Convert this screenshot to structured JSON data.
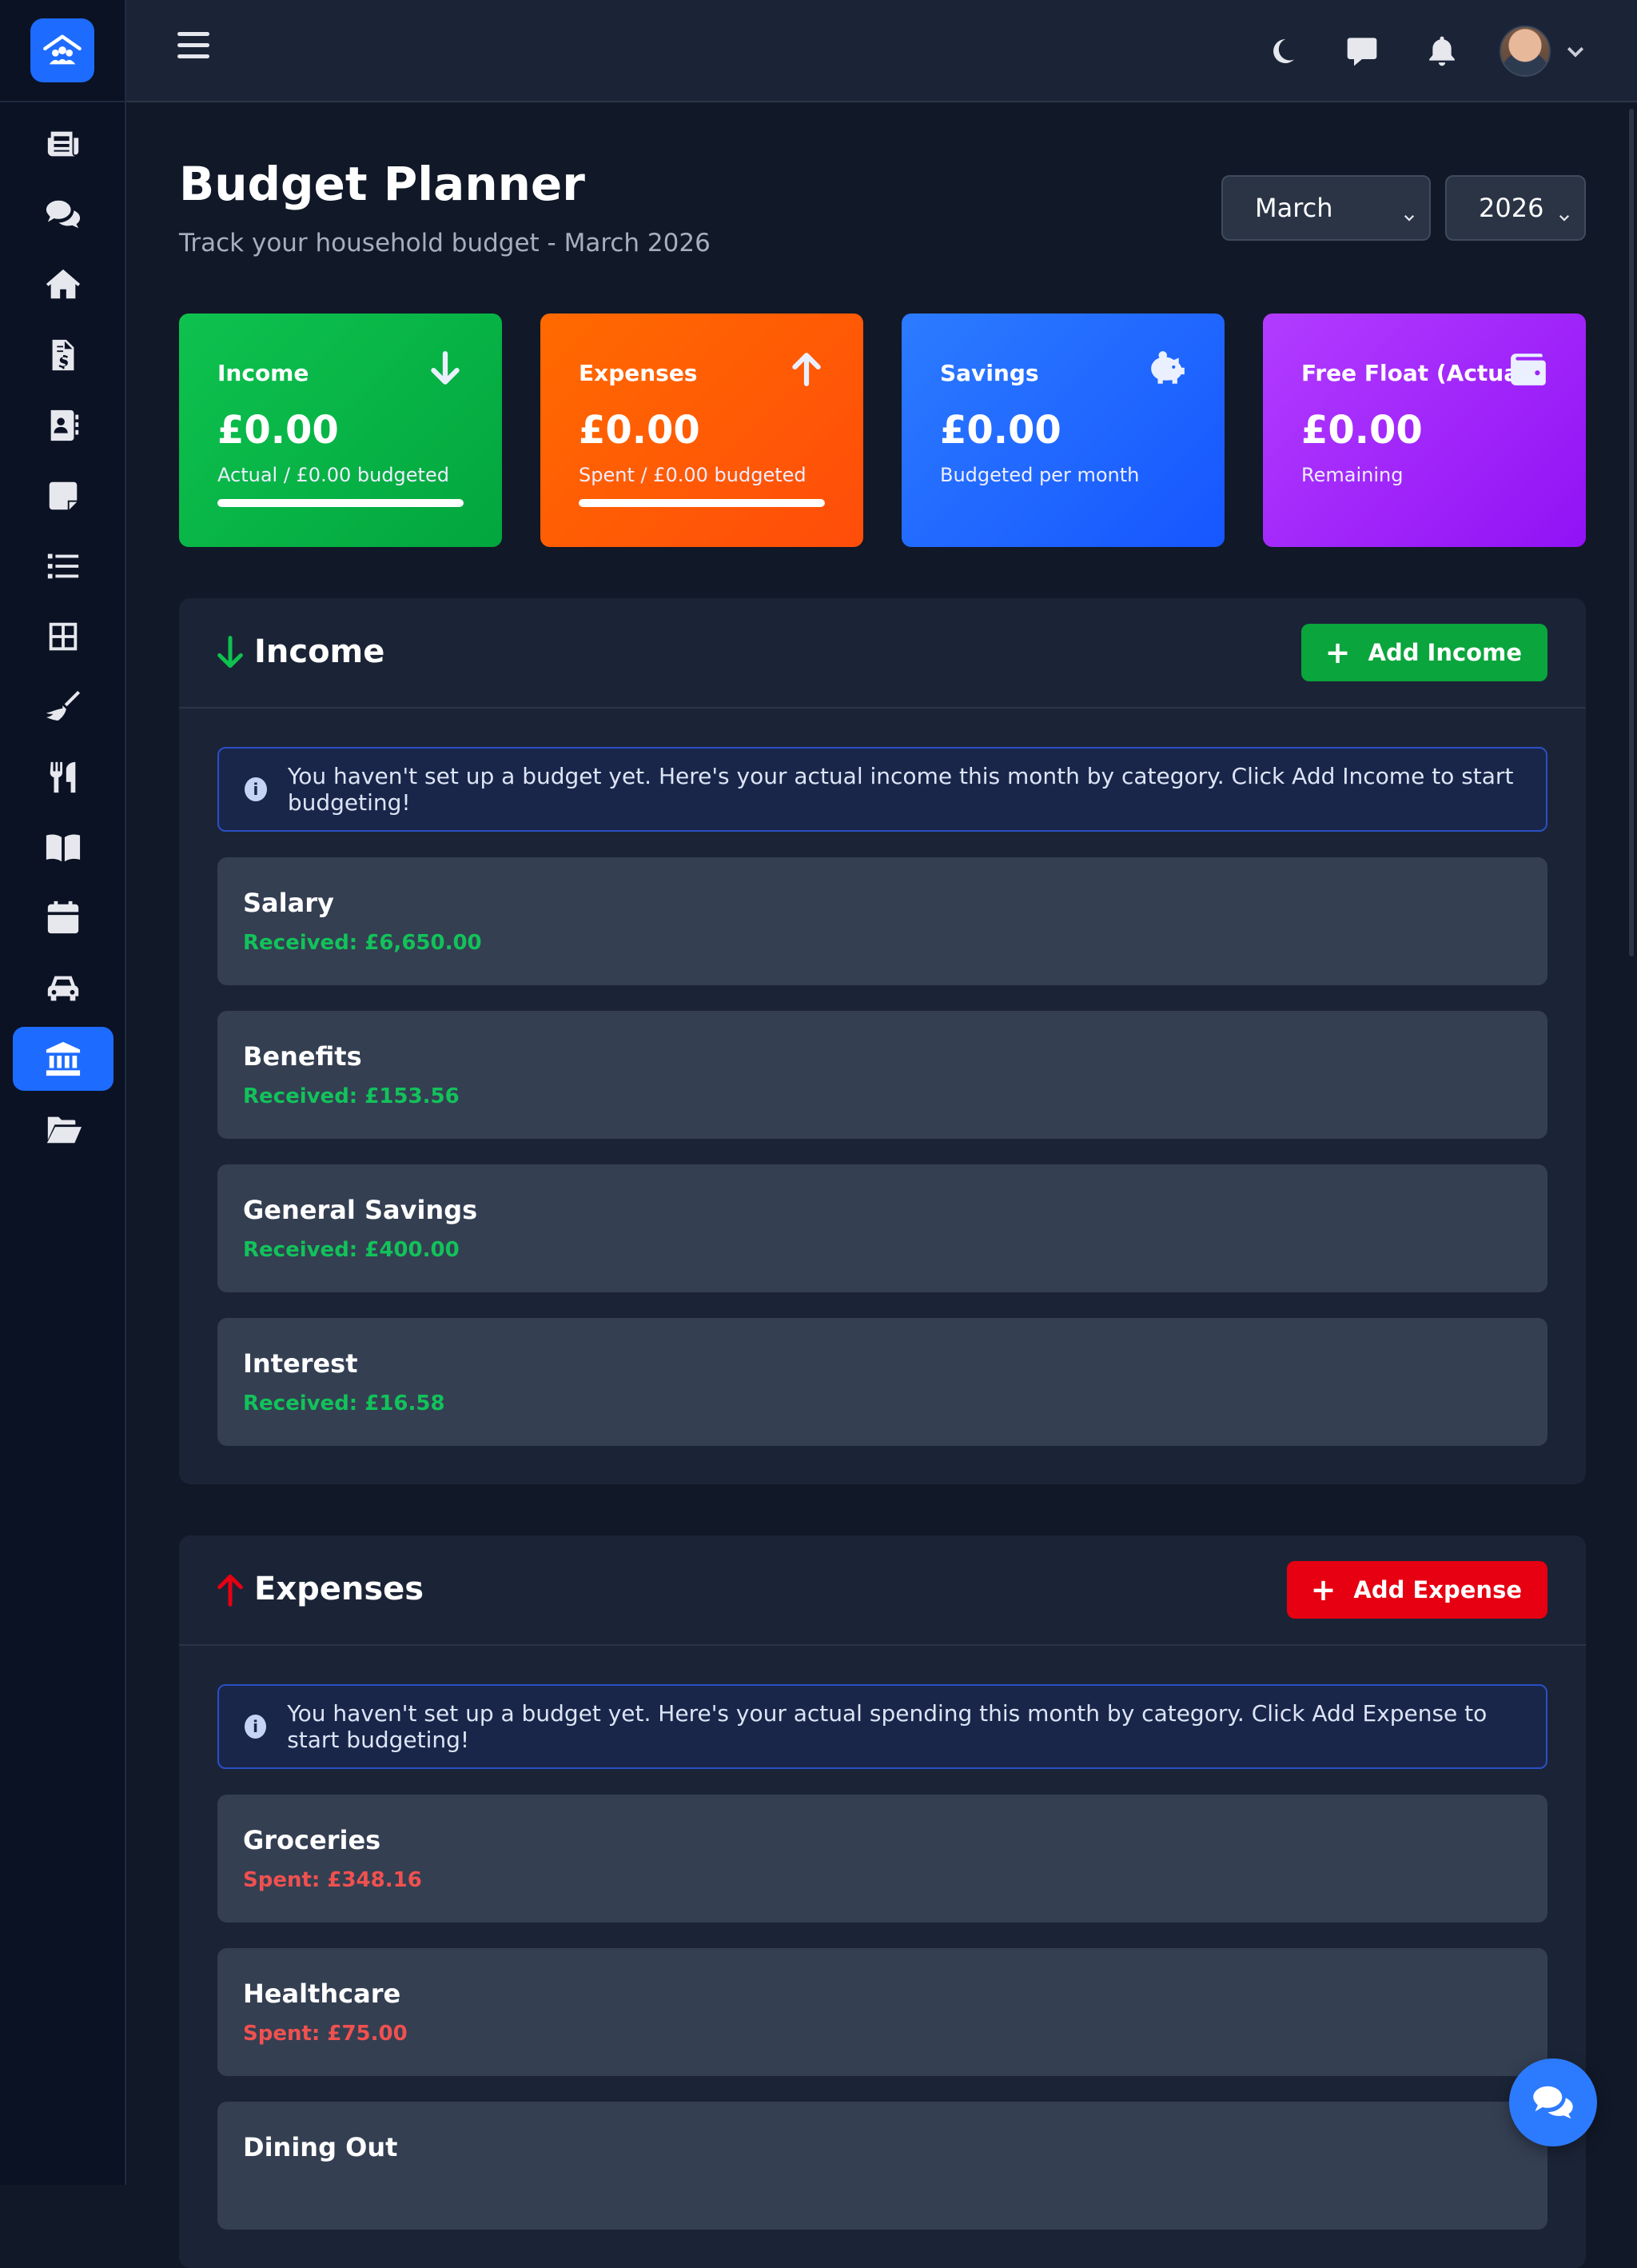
{
  "sidebar": {
    "items": [
      {
        "icon": "newspaper-icon"
      },
      {
        "icon": "chat-bubbles-icon"
      },
      {
        "icon": "home-icon"
      },
      {
        "icon": "invoice-icon"
      },
      {
        "icon": "contact-card-icon"
      },
      {
        "icon": "sticky-note-icon"
      },
      {
        "icon": "list-icon"
      },
      {
        "icon": "grid-icon"
      },
      {
        "icon": "broom-icon"
      },
      {
        "icon": "utensils-icon"
      },
      {
        "icon": "book-icon"
      },
      {
        "icon": "calendar-icon"
      },
      {
        "icon": "car-icon"
      },
      {
        "icon": "bank-icon",
        "active": true
      },
      {
        "icon": "folder-open-icon"
      }
    ],
    "active_color": "#1e6bff"
  },
  "header": {
    "title": "Budget Planner",
    "subtitle": "Track your household budget - March 2026",
    "month_select": "March",
    "year_select": "2026"
  },
  "stats": {
    "income": {
      "label": "Income",
      "value": "£0.00",
      "sub": "Actual / £0.00 budgeted",
      "progress": 1.0,
      "color": "#0ec24f"
    },
    "expenses": {
      "label": "Expenses",
      "value": "£0.00",
      "sub": "Spent / £0.00 budgeted",
      "progress": 1.0,
      "color": "#ff6a00"
    },
    "savings": {
      "label": "Savings",
      "value": "£0.00",
      "sub": "Budgeted per month",
      "color": "#2c7bff"
    },
    "float": {
      "label": "Free Float (Actual)",
      "value": "£0.00",
      "sub": "Remaining",
      "color": "#b23cff"
    }
  },
  "income_section": {
    "title": "Income",
    "add_label": "Add Income",
    "alert": "You haven't set up a budget yet. Here's your actual income this month by category. Click Add Income to start budgeting!",
    "items": [
      {
        "name": "Salary",
        "amount": "Received: £6,650.00"
      },
      {
        "name": "Benefits",
        "amount": "Received: £153.56"
      },
      {
        "name": "General Savings",
        "amount": "Received: £400.00"
      },
      {
        "name": "Interest",
        "amount": "Received: £16.58"
      }
    ]
  },
  "expense_section": {
    "title": "Expenses",
    "add_label": "Add Expense",
    "alert": "You haven't set up a budget yet. Here's your actual spending this month by category. Click Add Expense to start budgeting!",
    "items": [
      {
        "name": "Groceries",
        "amount": "Spent: £348.16"
      },
      {
        "name": "Healthcare",
        "amount": "Spent: £75.00"
      },
      {
        "name": "Dining Out",
        "amount": ""
      }
    ]
  }
}
